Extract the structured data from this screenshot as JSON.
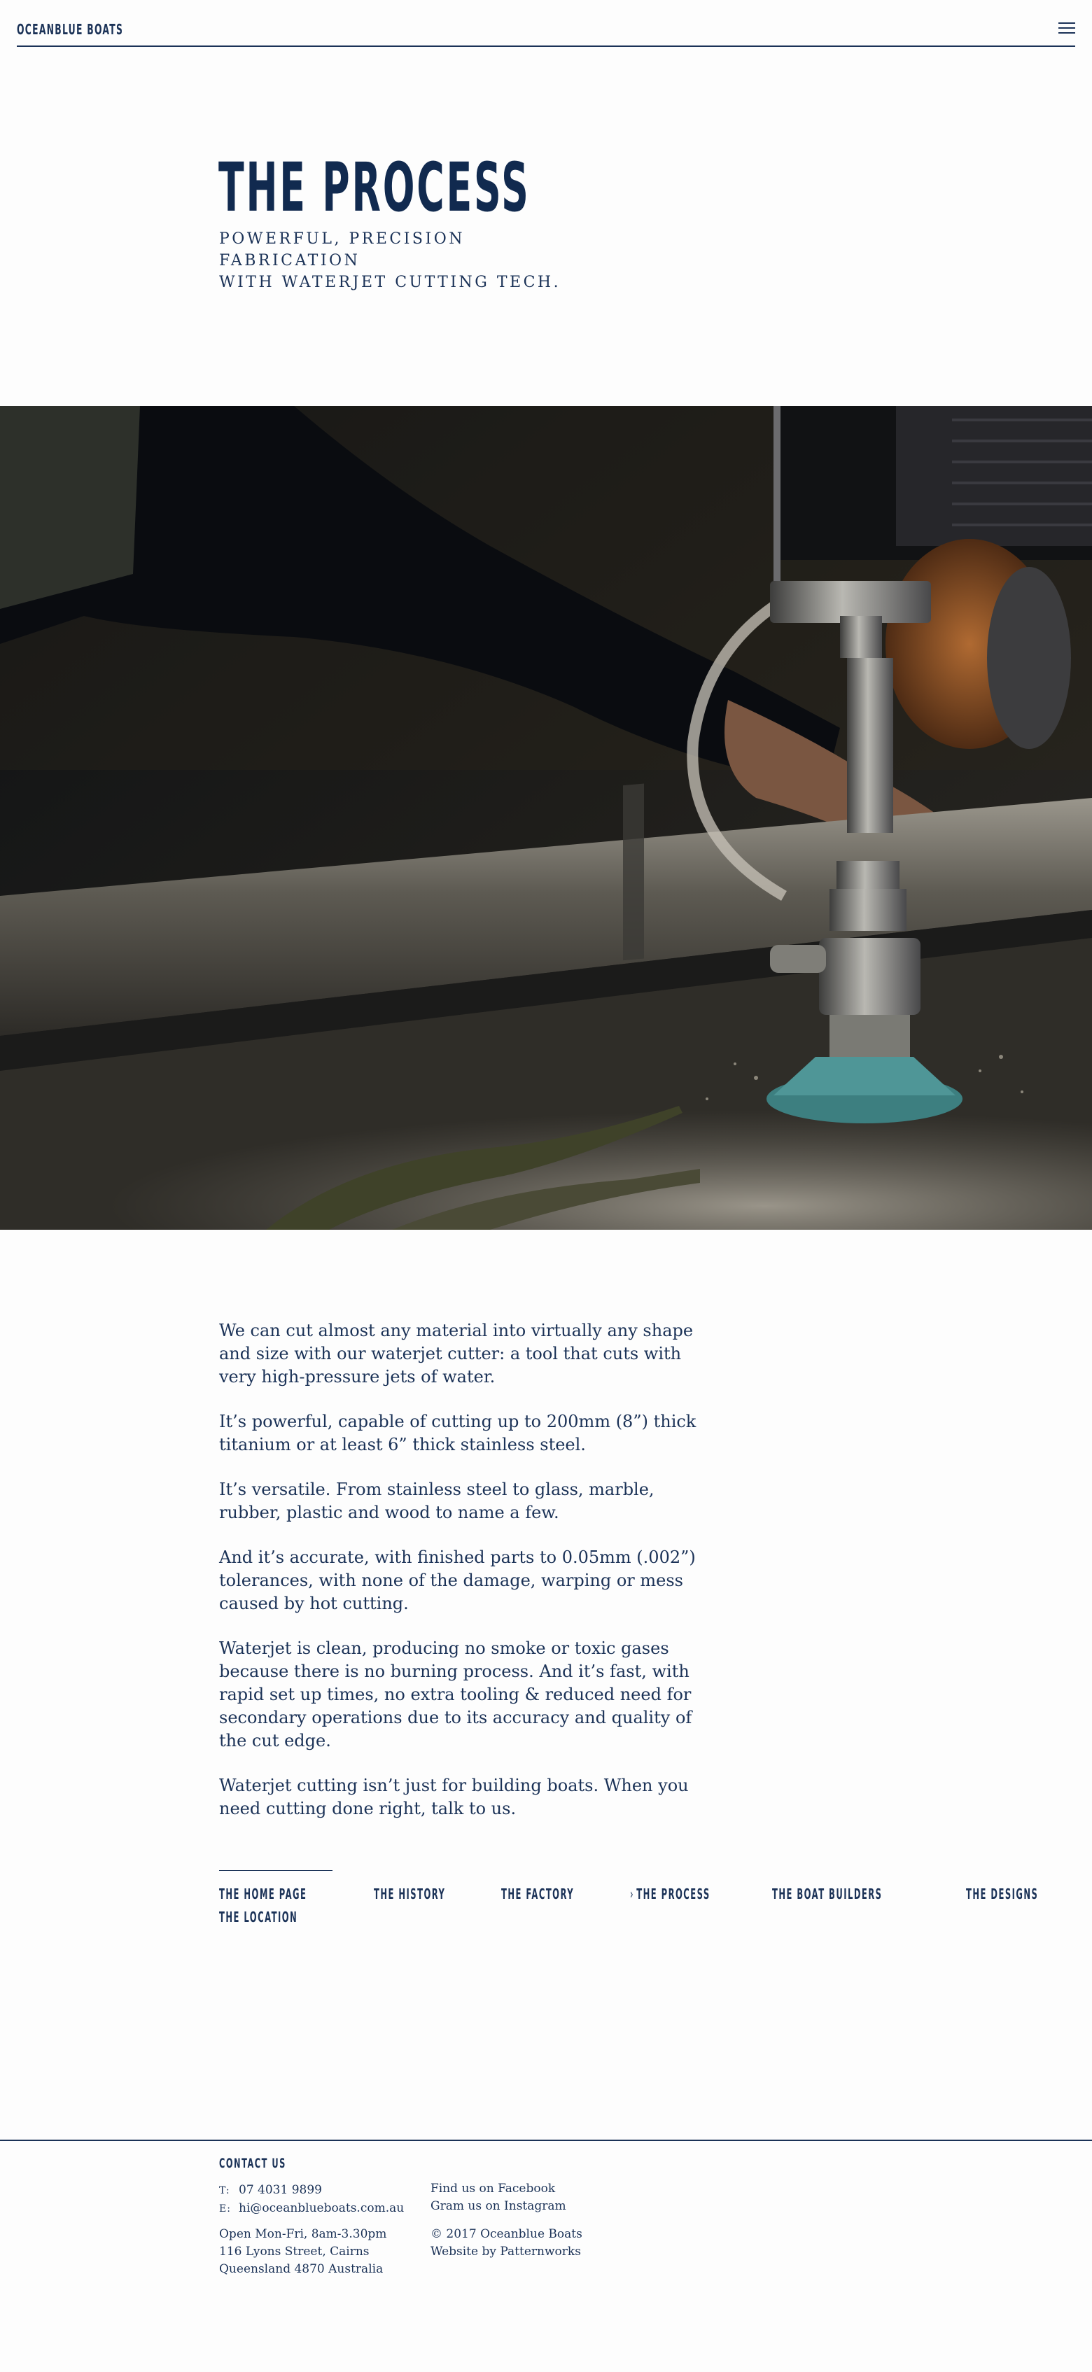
{
  "header": {
    "logo": "OCEANBLUE BOATS",
    "menu_icon": "hamburger-menu-icon"
  },
  "hero": {
    "title": "THE PROCESS",
    "subtitle_line1": "POWERFUL, PRECISION FABRICATION",
    "subtitle_line2": "WITH WATERJET CUTTING TECH."
  },
  "photo": {
    "alt": "waterjet cutter nozzle cutting metal"
  },
  "content": {
    "paragraphs": [
      "We can cut almost any material into virtually any shape and size with our waterjet cutter: a tool that cuts with very high-pressure jets of water.",
      "It’s powerful, capable of cutting up to 200mm (8”) thick titanium or at least 6” thick stainless steel.",
      "It’s versatile. From stainless steel to glass, marble, rubber, plastic and wood to name a few.",
      "And it’s accurate, with finished parts to 0.05mm (.002”) tolerances, with none of the damage, warping or mess caused by hot cutting.",
      "Waterjet is clean, producing no smoke or toxic gases because there is no burning process. And it’s fast, with rapid set up times, no extra tooling & reduced need for secondary operations due to its accuracy and quality of the cut edge.",
      "Waterjet cutting isn’t just for building boats. When you need cutting done right, talk to us."
    ]
  },
  "page_nav": {
    "active_marker": "›",
    "items": [
      {
        "label": "THE HOME PAGE",
        "active": false
      },
      {
        "label": "THE HISTORY",
        "active": false
      },
      {
        "label": "THE FACTORY",
        "active": false
      },
      {
        "label": "THE PROCESS",
        "active": true
      },
      {
        "label": "THE BOAT BUILDERS",
        "active": false
      },
      {
        "label": "THE DESIGNS",
        "active": false
      },
      {
        "label": "THE LOCATION",
        "active": false
      }
    ]
  },
  "footer": {
    "heading": "CONTACT US",
    "phone_key": "T:",
    "phone": "07 4031 9899",
    "email_key": "E:",
    "email": "hi@oceanblueboats.com.au",
    "hours": "Open Mon-Fri, 8am-3.30pm",
    "address_line1": "116 Lyons Street, Cairns",
    "address_line2": "Queensland 4870 Australia",
    "facebook": "Find us on Facebook",
    "instagram": "Gram us on Instagram",
    "copyright": "© 2017 Oceanblue Boats",
    "credit": "Website by Patternworks"
  },
  "colors": {
    "navy": "#1b3257",
    "background": "#fdfdfd"
  }
}
